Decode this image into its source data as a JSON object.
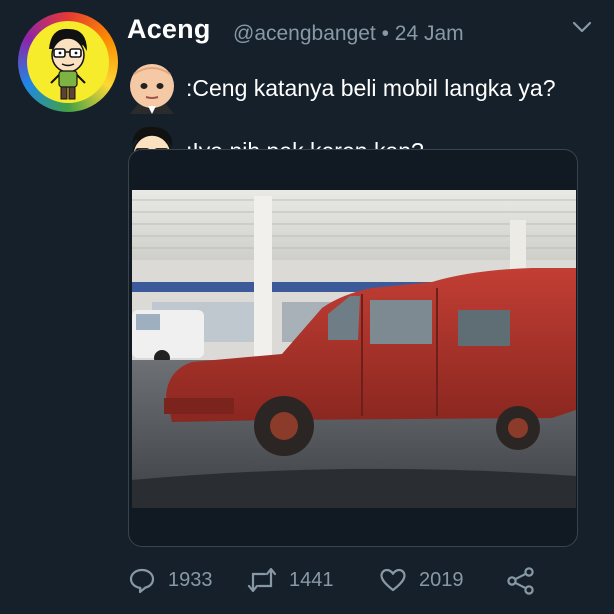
{
  "tweet": {
    "author_name": "Aceng",
    "handle_line": "@acengbanget • 24 Jam"
  },
  "chat": [
    {
      "speaker_icon": "boss-baby-avatar-icon",
      "text": ":Ceng katanya beli mobil langka ya?"
    },
    {
      "speaker_icon": "aceng-cartoon-avatar-icon",
      "text": ":Iya nih pak keren kan?"
    }
  ],
  "media": {
    "subject": "rusty-red-car-photo"
  },
  "actions": {
    "reply_count": "1933",
    "retweet_count": "1441",
    "like_count": "2019"
  },
  "icons": {
    "reply": "reply-icon",
    "retweet": "retweet-icon",
    "like": "heart-icon",
    "share": "share-icon",
    "menu": "chevron-down-icon"
  },
  "colors": {
    "background": "#15202b",
    "muted_text": "#8899a6",
    "border": "#38444d",
    "avatar_bg": "#f7ec2c",
    "car_red": "#a8302a"
  }
}
